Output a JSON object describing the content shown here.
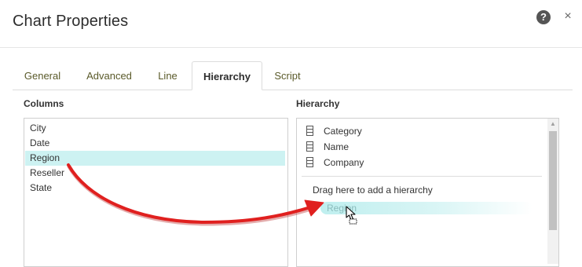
{
  "dialog": {
    "title": "Chart Properties",
    "help_glyph": "?",
    "close_glyph": "×"
  },
  "tabs": [
    {
      "label": "General",
      "active": false
    },
    {
      "label": "Advanced",
      "active": false
    },
    {
      "label": "Line",
      "active": false
    },
    {
      "label": "Hierarchy",
      "active": true
    },
    {
      "label": "Script",
      "active": false
    }
  ],
  "columns": {
    "label": "Columns",
    "items": [
      "City",
      "Date",
      "Region",
      "Reseller",
      "State"
    ],
    "selected": "Region"
  },
  "hierarchy": {
    "label": "Hierarchy",
    "items": [
      "Category",
      "Name",
      "Company"
    ],
    "drop_hint": "Drag here to add a hierarchy",
    "dragging_item": "Region"
  },
  "colors": {
    "selection": "#cdf2f2",
    "arrow": "#e0201f",
    "tab_text": "#5a5a2a"
  },
  "icons": {
    "help": "help-circle-icon",
    "close": "close-icon",
    "hierarchy_item": "hierarchy-level-icon",
    "cursor": "move-cursor-icon",
    "scroll_up": "scroll-up-arrow-icon"
  }
}
